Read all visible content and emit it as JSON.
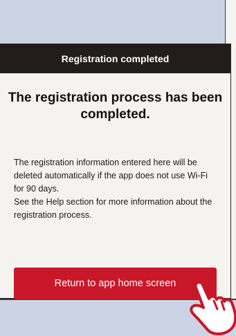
{
  "dialog": {
    "header": "Registration completed",
    "title": "The registration process has been completed.",
    "body_paragraph_1": "The registration information entered here will be deleted automatically if the app does not use Wi-Fi for 90 days.",
    "body_paragraph_2": "See the Help section for more information about the registration process.",
    "button_label": "Return to app home screen"
  },
  "colors": {
    "background": "#ccd3e4",
    "header_bg": "#221c1a",
    "dialog_bg": "#f4f3ef",
    "button_bg": "#c9172a",
    "hand_outline": "#c9172a"
  },
  "icons": {
    "pointer": "hand-pointer-icon"
  }
}
